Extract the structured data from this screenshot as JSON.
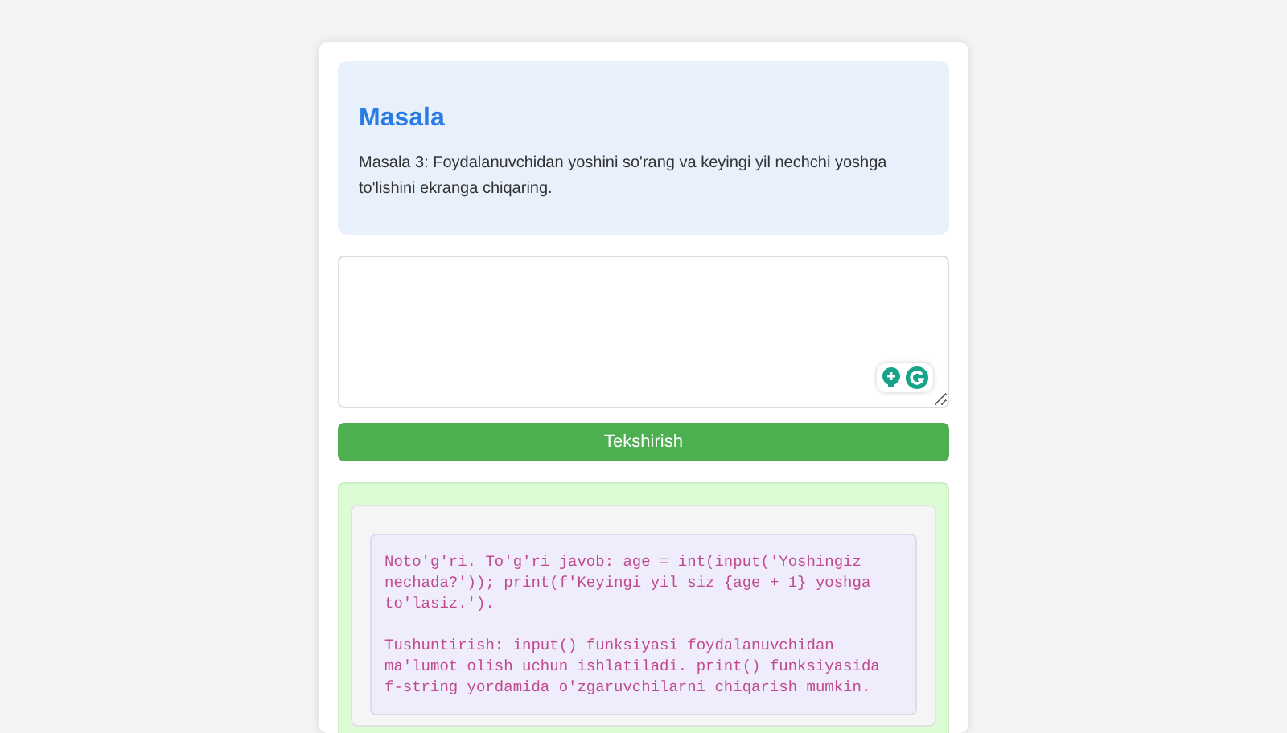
{
  "problem": {
    "title": "Masala",
    "text": "Masala 3: Foydalanuvchidan yoshini so'rang va keyingi yil nechchi yoshga to'lishini ekranga chiqaring."
  },
  "check_button": {
    "label": "Tekshirish"
  },
  "result": {
    "verdict": "Noto'g'ri. To'g'ri javob: age = int(input('Yoshingiz nechada?')); print(f'Keyingi yil siz {age + 1} yoshga to'lasiz.').",
    "explanation": "Tushuntirish: input() funksiyasi foydalanuvchidan ma'lumot olish uchun ishlatiladi. print() funksiyasida f-string yordamida o'zgaruvchilarni chiqarish mumkin."
  }
}
